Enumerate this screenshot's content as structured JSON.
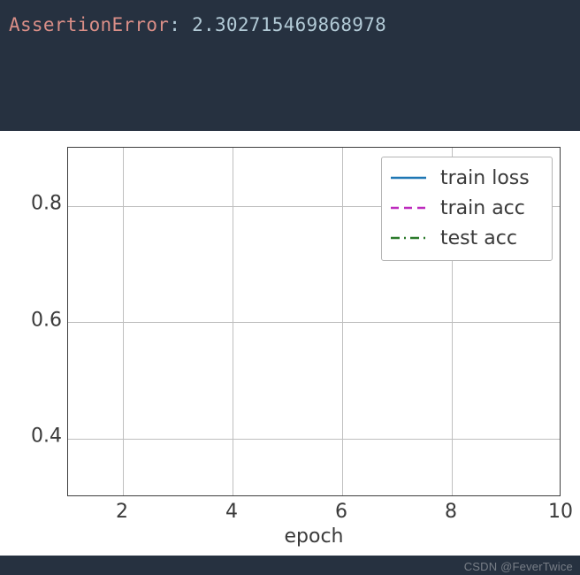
{
  "error": {
    "name": "AssertionError",
    "sep": ": ",
    "value": "2.302715469868978"
  },
  "chart_data": {
    "type": "line",
    "title": "",
    "xlabel": "epoch",
    "ylabel": "",
    "xlim": [
      1,
      10
    ],
    "ylim": [
      0.3,
      0.9
    ],
    "xticks": [
      2,
      4,
      6,
      8,
      10
    ],
    "yticks": [
      0.4,
      0.6,
      0.8
    ],
    "grid": true,
    "legend_position": "upper-right",
    "series": [
      {
        "name": "train loss",
        "color": "#1f77b4",
        "style": "solid",
        "x": [],
        "y": []
      },
      {
        "name": "train acc",
        "color": "#bd2bbd",
        "style": "dashed",
        "x": [],
        "y": []
      },
      {
        "name": "test acc",
        "color": "#2b7a2b",
        "style": "dashdot",
        "x": [],
        "y": []
      }
    ]
  },
  "watermark": "CSDN @FeverTwice"
}
